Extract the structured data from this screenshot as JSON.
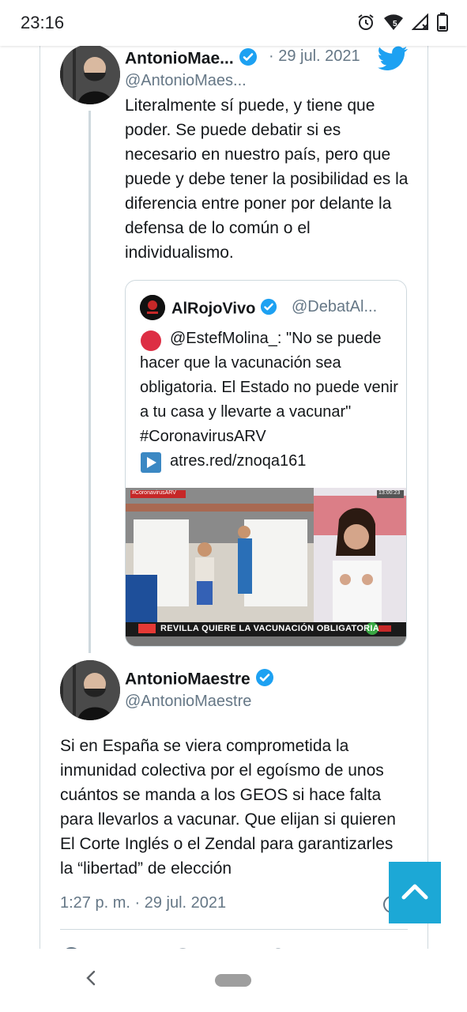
{
  "status_bar": {
    "time": "23:16",
    "signal_badge": "5",
    "icons": [
      "alarm-icon",
      "wifi-icon",
      "signal-icon",
      "battery-icon"
    ]
  },
  "reply_tweet": {
    "author_name": "AntonioMae...",
    "handle": "@AntonioMaes...",
    "date": "· 29 jul. 2021",
    "text": "Literalmente sí puede, y tiene que poder. Se puede debatir si es necesario en nuestro país, pero que puede y debe tener la posibilidad es la diferencia entre poner por delante la defensa de lo común o el individualismo."
  },
  "quoted_tweet": {
    "author_name": "AlRojoVivo",
    "handle": "@DebatAl...",
    "text_line1": "@EstefMolina_: \"No se puede hacer que la vacunación sea obligatoria. El Estado no puede venir a tu casa y llevarte a vacunar\"  #CoronavirusARV",
    "link": "atres.red/znoqa161",
    "media_banner": "REVILLA QUIERE LA VACUNACIÓN OBLIGATORIA",
    "media_tag": "#CoronavirusARV",
    "media_clock": "13:00:23"
  },
  "main_tweet": {
    "author_name": "AntonioMaestre",
    "handle": "@AntonioMaestre",
    "text": "Si en España se viera comprometida la inmunidad colectiva por el egoísmo de unos cuántos se manda a los GEOS si hace falta para llevarlos a vacunar. Que elijan si quieren El Corte Inglés o el Zendal para garantizarles la “libertad” de elección",
    "timestamp": "1:27 p. m. · 29 jul. 2021"
  },
  "colors": {
    "twitter_blue": "#1da1f2",
    "fab_blue": "#1ca8d6",
    "text_secondary": "#657786",
    "border": "#cfd9de"
  }
}
